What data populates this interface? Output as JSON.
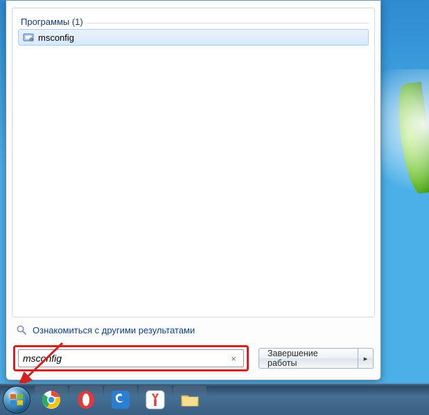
{
  "start_menu": {
    "programs_header": "Программы (1)",
    "result": {
      "name": "msconfig"
    },
    "more_results_label": "Ознакомиться с другими результатами",
    "search_value": "msconfig",
    "clear_glyph": "×",
    "shutdown_label": "Завершение работы",
    "shutdown_arrow": "▸"
  },
  "taskbar": {
    "items": [
      {
        "id": "chrome"
      },
      {
        "id": "opera"
      },
      {
        "id": "mxthree"
      },
      {
        "id": "yandex"
      },
      {
        "id": "explorer"
      }
    ]
  }
}
